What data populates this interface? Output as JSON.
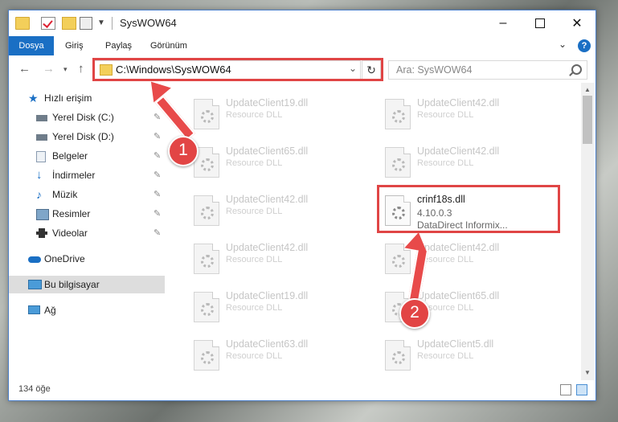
{
  "window": {
    "title": "SysWOW64",
    "min_label": "–",
    "close_label": "✕"
  },
  "ribbon": {
    "tabs": [
      "Dosya",
      "Giriş",
      "Paylaş",
      "Görünüm"
    ],
    "chevron": "⌄",
    "help": "?"
  },
  "nav": {
    "back": "←",
    "forward": "→",
    "recent": "▾",
    "up": "↑",
    "address": "C:\\Windows\\SysWOW64",
    "address_drop": "⌄",
    "refresh": "↻",
    "search_placeholder": "Ara: SysWOW64"
  },
  "sidebar": {
    "quick_access": "Hızlı erişim",
    "items": [
      {
        "label": "Yerel Disk (C:)",
        "icon": "drive-icon"
      },
      {
        "label": "Yerel Disk (D:)",
        "icon": "drive-icon"
      },
      {
        "label": "Belgeler",
        "icon": "documents-icon"
      },
      {
        "label": "İndirmeler",
        "icon": "downloads-icon"
      },
      {
        "label": "Müzik",
        "icon": "music-icon"
      },
      {
        "label": "Resimler",
        "icon": "pictures-icon"
      },
      {
        "label": "Videolar",
        "icon": "videos-icon"
      }
    ],
    "onedrive": "OneDrive",
    "this_pc": "Bu bilgisayar",
    "network": "Ağ",
    "pin": "📌"
  },
  "files_left": [
    {
      "name": "UpdateClient19.dll",
      "desc": "Resource DLL"
    },
    {
      "name": "UpdateClient65.dll",
      "desc": "Resource DLL"
    },
    {
      "name": "UpdateClient42.dll",
      "desc": "Resource DLL"
    },
    {
      "name": "UpdateClient42.dll",
      "desc": "Resource DLL"
    },
    {
      "name": "UpdateClient19.dll",
      "desc": "Resource DLL"
    },
    {
      "name": "UpdateClient63.dll",
      "desc": "Resource DLL"
    }
  ],
  "files_right": [
    {
      "name": "UpdateClient42.dll",
      "desc": "Resource DLL"
    },
    {
      "name": "UpdateClient42.dll",
      "desc": "Resource DLL"
    },
    {
      "name": "UpdateClient42.dll",
      "desc": "Resource DLL"
    },
    {
      "name": "UpdateClient65.dll",
      "desc": "Resource DLL"
    },
    {
      "name": "UpdateClient5.dll",
      "desc": "Resource DLL"
    }
  ],
  "highlighted_file": {
    "name": "crinf18s.dll",
    "version": "4.10.0.3",
    "desc": "DataDirect Informix..."
  },
  "status": {
    "item_count": "134 öğe"
  },
  "annotations": {
    "step1": "1",
    "step2": "2",
    "color": "#e24545"
  }
}
